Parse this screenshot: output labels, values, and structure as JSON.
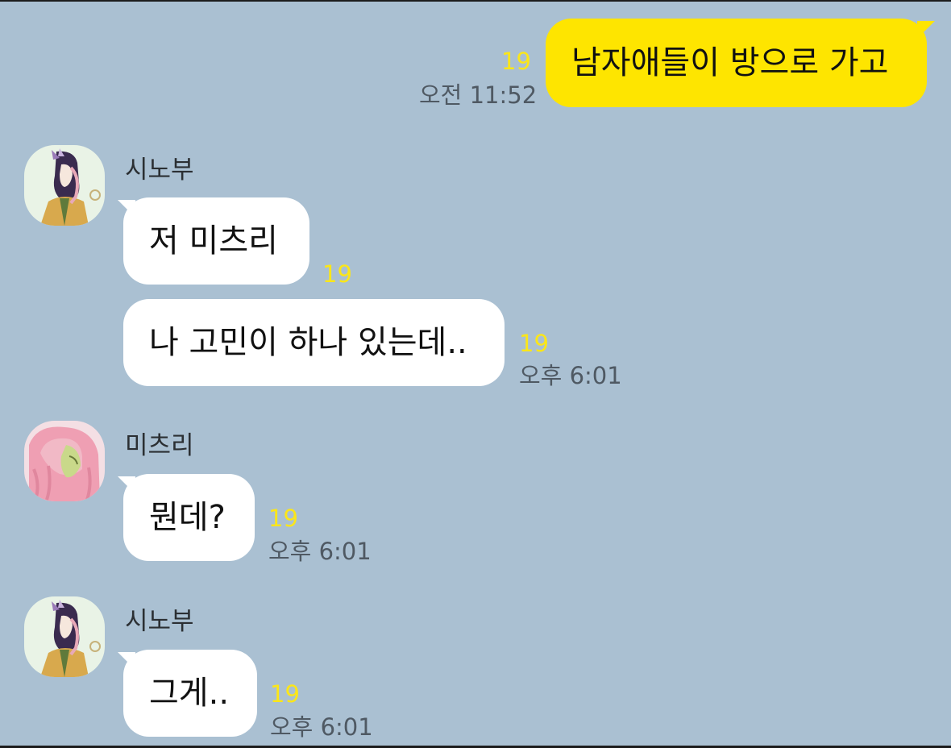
{
  "chat": {
    "messages": [
      {
        "direction": "outgoing",
        "text": "남자애들이 방으로 가고",
        "unread": "19",
        "time": "오전 11:52"
      },
      {
        "direction": "incoming",
        "sender": "시노부",
        "text": "저 미츠리",
        "unread": "19"
      },
      {
        "direction": "incoming",
        "text": "나 고민이 하나 있는데..",
        "unread": "19",
        "time": "오후 6:01"
      },
      {
        "direction": "incoming",
        "sender": "미츠리",
        "text": "뭔데?",
        "unread": "19",
        "time": "오후 6:01"
      },
      {
        "direction": "incoming",
        "sender": "시노부",
        "text": "그게..",
        "unread": "19",
        "time": "오후 6:01"
      }
    ]
  },
  "theme": {
    "background": "#aac0d2",
    "incoming_bubble": "#ffffff",
    "outgoing_bubble": "#fee500",
    "unread_color": "#fbe619",
    "time_color": "#4f5963"
  },
  "avatars": {
    "shinobu": {
      "icon": "shinobu-avatar-icon"
    },
    "mitsuri": {
      "icon": "mitsuri-avatar-icon"
    }
  }
}
